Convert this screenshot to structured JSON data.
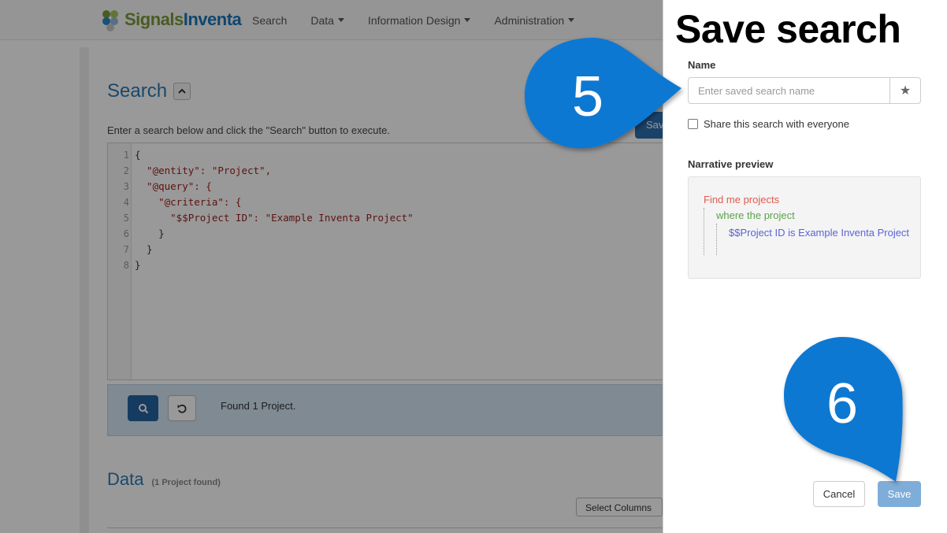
{
  "navbar": {
    "brand_part1": "Signals",
    "brand_part2": "Inventa",
    "items": [
      {
        "label": "Search",
        "dropdown": false
      },
      {
        "label": "Data",
        "dropdown": true
      },
      {
        "label": "Information Design",
        "dropdown": true
      },
      {
        "label": "Administration",
        "dropdown": true
      }
    ]
  },
  "search": {
    "heading": "Search",
    "hint": "Enter a search below and click the \"Search\" button to execute.",
    "save_button_partial": "Sav"
  },
  "editor": {
    "lines": [
      {
        "no": "1",
        "text": "{"
      },
      {
        "no": "2",
        "text": "  \"@entity\": \"Project\","
      },
      {
        "no": "3",
        "text": "  \"@query\": {"
      },
      {
        "no": "4",
        "text": "    \"@criteria\": {"
      },
      {
        "no": "5",
        "text": "      \"$$Project ID\": \"Example Inventa Project\""
      },
      {
        "no": "6",
        "text": "    }"
      },
      {
        "no": "7",
        "text": "  }"
      },
      {
        "no": "8",
        "text": "}"
      }
    ]
  },
  "results": {
    "found_text": "Found 1 Project."
  },
  "data_section": {
    "heading": "Data",
    "count": "(1 Project  found)",
    "select_columns": "Select Columns"
  },
  "save_panel": {
    "title": "Save search",
    "name_label": "Name",
    "name_placeholder": "Enter saved search name",
    "name_value": "",
    "share_label": "Share this search with everyone",
    "share_checked": false,
    "preview_label": "Narrative preview",
    "preview": {
      "line1": "Find me projects",
      "line2": "where the project",
      "line3": "$$Project ID is Example Inventa Project"
    },
    "cancel_label": "Cancel",
    "save_label": "Save"
  },
  "callouts": {
    "step5": "5",
    "step6": "6",
    "color": "#0a78d2"
  },
  "colors": {
    "accent": "#2a7ab5",
    "primary_button": "#2563a0",
    "save_disabled": "#7fadd9",
    "preview_red": "#e05a4f",
    "preview_green": "#5aa44a",
    "preview_blue": "#5c63d6"
  }
}
